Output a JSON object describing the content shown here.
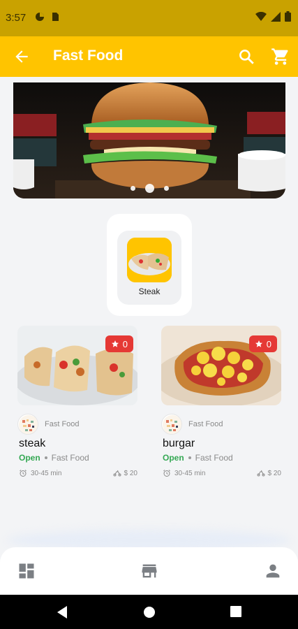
{
  "status_bar": {
    "time": "3:57"
  },
  "app_bar": {
    "title": "Fast Food"
  },
  "banner": {
    "slide_count": 3,
    "active_slide": 1
  },
  "categories": [
    {
      "label": "Steak"
    }
  ],
  "products": [
    {
      "name": "steak",
      "rating": "0",
      "restaurant": "Fast Food",
      "status": "Open",
      "category": "Fast Food",
      "delivery_time": "30-45 min",
      "delivery_fee": "$ 20"
    },
    {
      "name": "burgar",
      "rating": "0",
      "restaurant": "Fast Food",
      "status": "Open",
      "category": "Fast Food",
      "delivery_time": "30-45 min",
      "delivery_fee": "$ 20"
    }
  ],
  "colors": {
    "primary": "#ffc400",
    "status_bar": "#c9a200",
    "open": "#34a853",
    "rating_badge": "#e53935"
  },
  "icons": {
    "app_bar": [
      "back-arrow-icon",
      "search-icon",
      "cart-icon"
    ],
    "bottom_nav": [
      "dashboard-icon",
      "store-icon",
      "person-icon"
    ],
    "system_nav": [
      "back-triangle-icon",
      "home-circle-icon",
      "recents-square-icon"
    ]
  }
}
